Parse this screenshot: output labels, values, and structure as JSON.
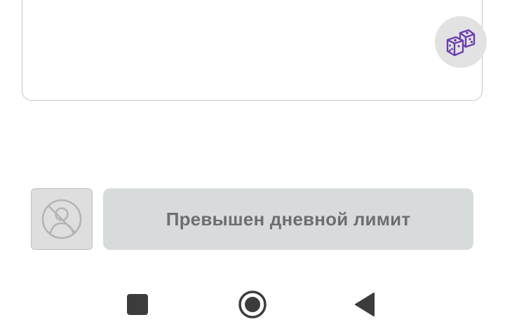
{
  "text_card": {
    "dice_icon": "dice-icon"
  },
  "action_row": {
    "avatar_icon": "no-avatar-icon",
    "limit_button_label": "Превышен дневной лимит"
  },
  "nav_bar": {
    "recents_icon": "square-icon",
    "home_icon": "circle-icon",
    "back_icon": "triangle-back-icon"
  },
  "colors": {
    "dice_accent": "#6a3fb0",
    "limit_text": "#6e6e72",
    "limit_bg": "#d8dbdb",
    "nav_icons": "#3c3c3c"
  }
}
